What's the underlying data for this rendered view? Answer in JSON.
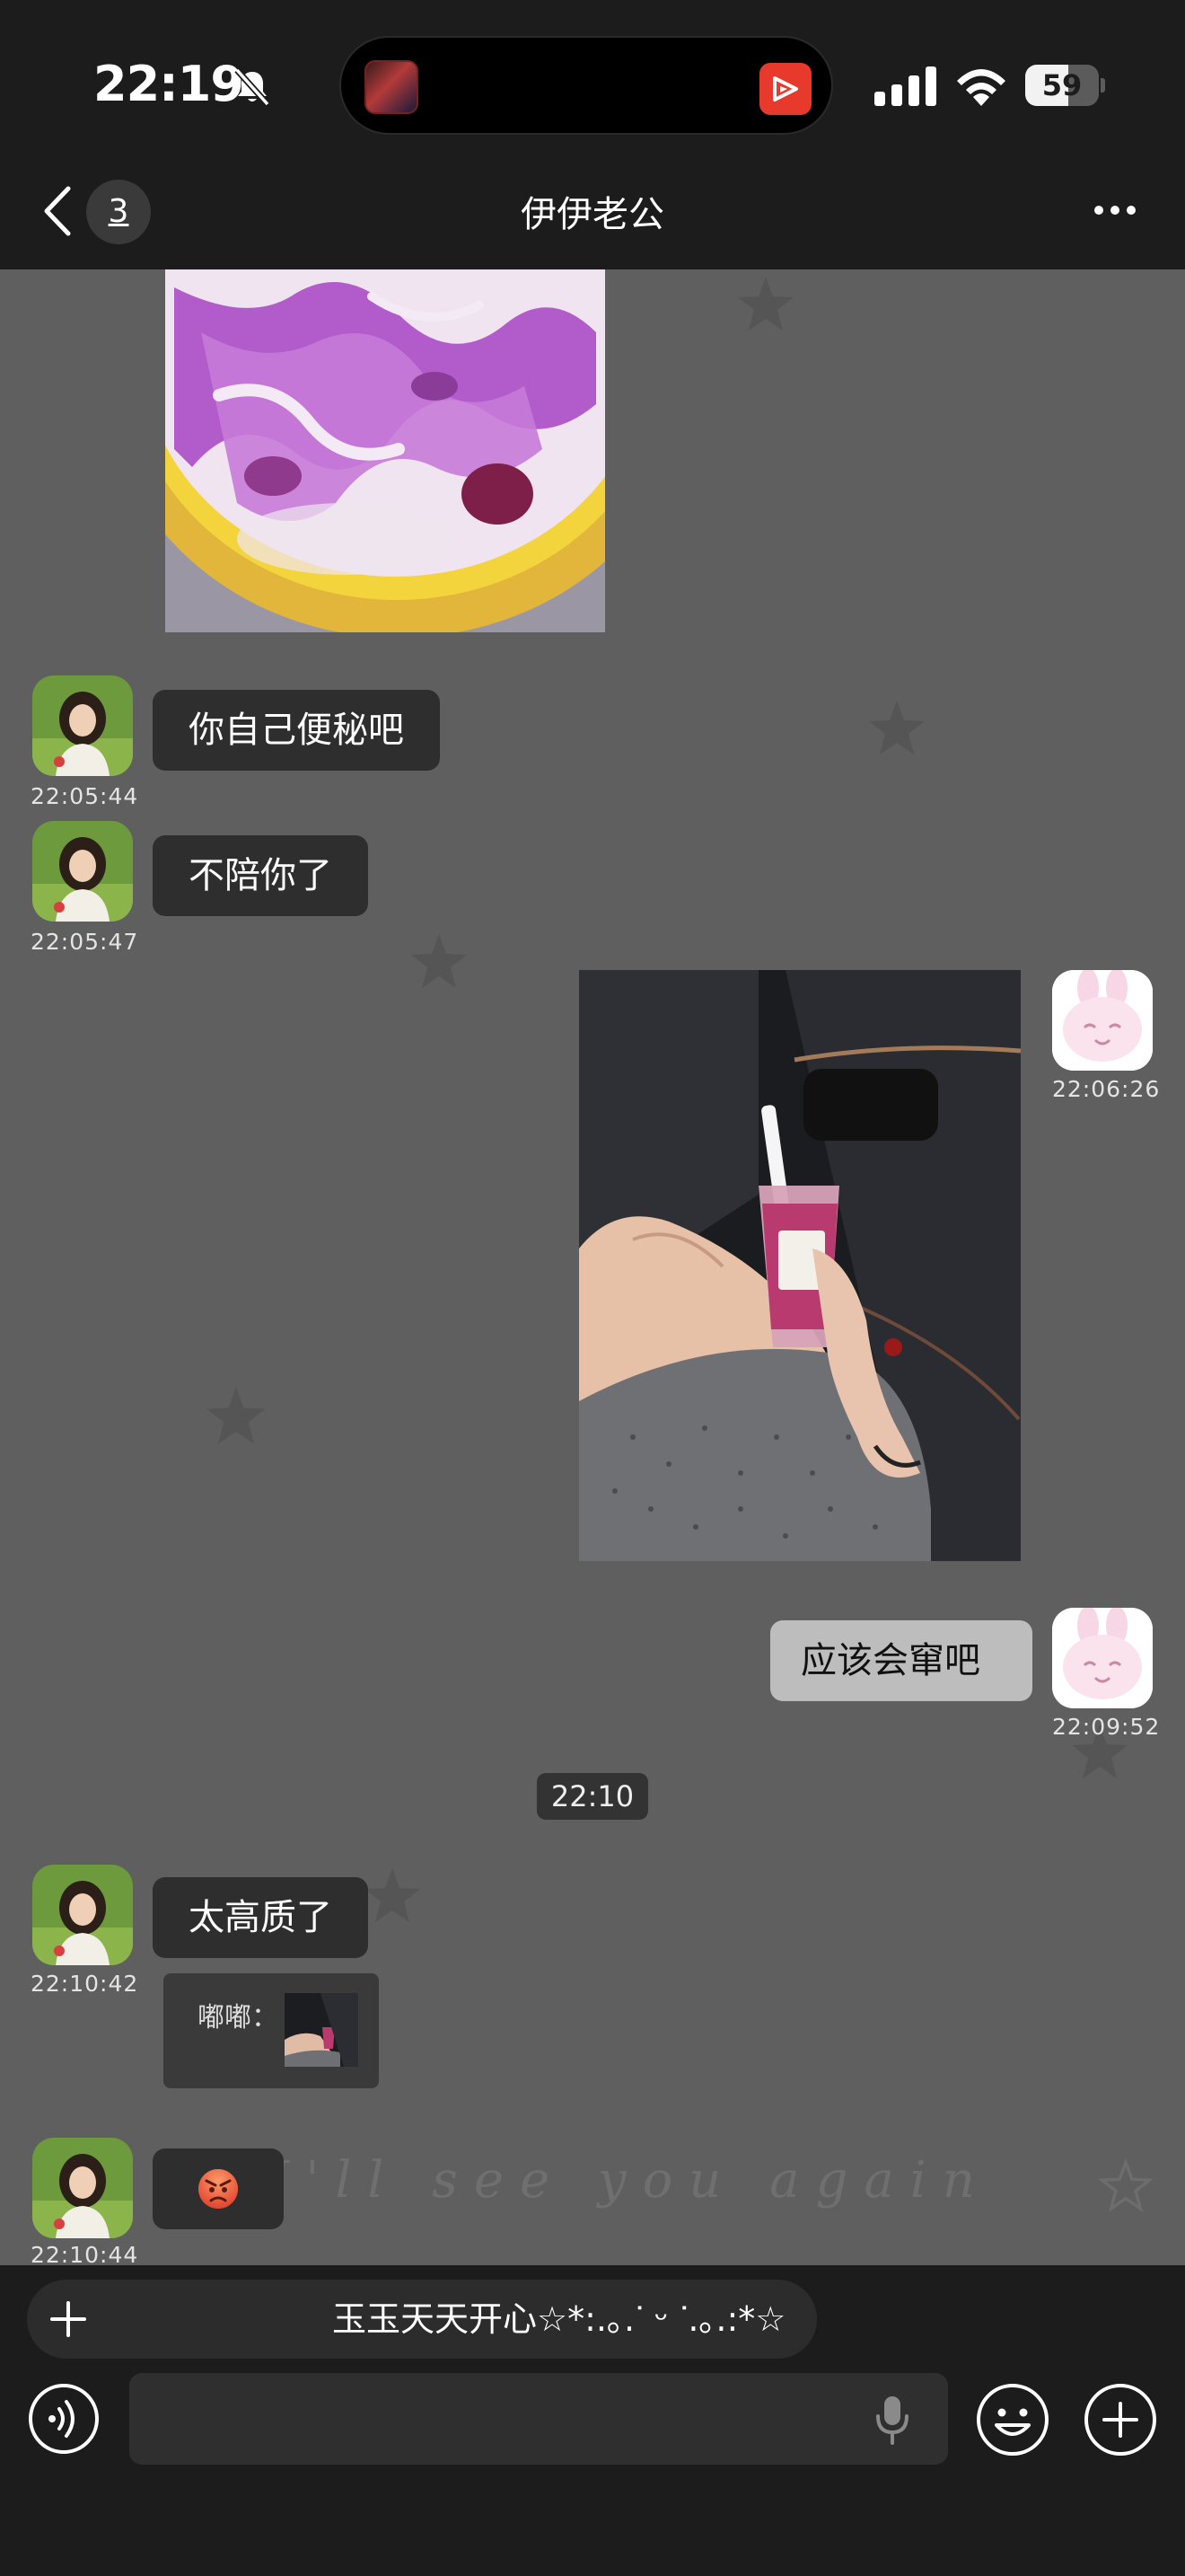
{
  "status_bar": {
    "time": "22:19",
    "battery_percent": "59",
    "battery_level": 0.59
  },
  "header": {
    "unread_count": "3",
    "title": "伊伊老公"
  },
  "messages": [
    {
      "type": "image",
      "sender": "her",
      "content": "purple-dragonfruit-yogurt-bowl-photo"
    },
    {
      "type": "text",
      "sender": "her",
      "text": "你自己便秘吧",
      "time": "22:05:44"
    },
    {
      "type": "text",
      "sender": "her",
      "text": "不陪你了",
      "time": "22:05:47"
    },
    {
      "type": "image",
      "sender": "me",
      "content": "drink-cup-in-car-photo",
      "time": "22:06:26"
    },
    {
      "type": "text",
      "sender": "me",
      "text": "应该会窜吧",
      "time": "22:09:52"
    },
    {
      "type": "time_divider",
      "text": "22:10"
    },
    {
      "type": "text",
      "sender": "her",
      "text": "太高质了",
      "time": "22:10:42",
      "quote_label": "嘟嘟："
    },
    {
      "type": "emoji",
      "sender": "her",
      "content": "angry-face-emoji",
      "time": "22:10:44"
    }
  ],
  "background": {
    "handwriting": "I'll see you again"
  },
  "input_bar": {
    "quick_text": "玉玉天天开心☆*:.｡.ᐝ ᵕ ᐝ.｡.:*☆",
    "input_value": ""
  },
  "colors": {
    "chat_bg": "#5f5f5f",
    "header_bg": "#1c1c1c",
    "incoming_bubble": "#2e2e2e",
    "outgoing_bubble": "#bdbdbd"
  }
}
